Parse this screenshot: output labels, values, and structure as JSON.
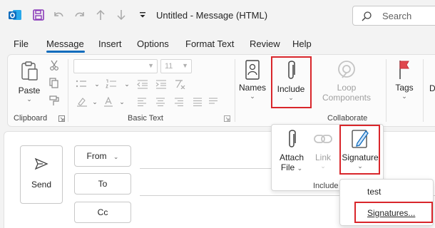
{
  "window": {
    "title": "Untitled  -  Message (HTML)",
    "search_placeholder": "Search"
  },
  "menu_tabs": [
    "File",
    "Message",
    "Insert",
    "Options",
    "Format Text",
    "Review",
    "Help"
  ],
  "active_tab": "Message",
  "ribbon": {
    "clipboard": {
      "paste_label": "Paste",
      "group_label": "Clipboard"
    },
    "basic_text": {
      "font_name": "",
      "font_size": "11",
      "group_label": "Basic Text"
    },
    "names_label": "Names",
    "include_label": "Include",
    "loop_label_1": "Loop",
    "loop_label_2": "Components",
    "collaborate_label": "Collaborate",
    "tags_label": "Tags",
    "cut_label": "D"
  },
  "compose": {
    "send_label": "Send",
    "from_label": "From",
    "to_label": "To",
    "cc_label": "Cc"
  },
  "include_panel": {
    "attach_label_1": "Attach",
    "attach_label_2": "File",
    "link_label": "Link",
    "signature_label": "Signature",
    "group_label": "Include"
  },
  "signature_menu": {
    "items": [
      "test",
      "Signatures..."
    ]
  },
  "colors": {
    "accent": "#0f6cbd",
    "highlight_box": "#d9262b",
    "outlook_blue": "#0f6cbd",
    "save_purple": "#8a3ab9"
  }
}
